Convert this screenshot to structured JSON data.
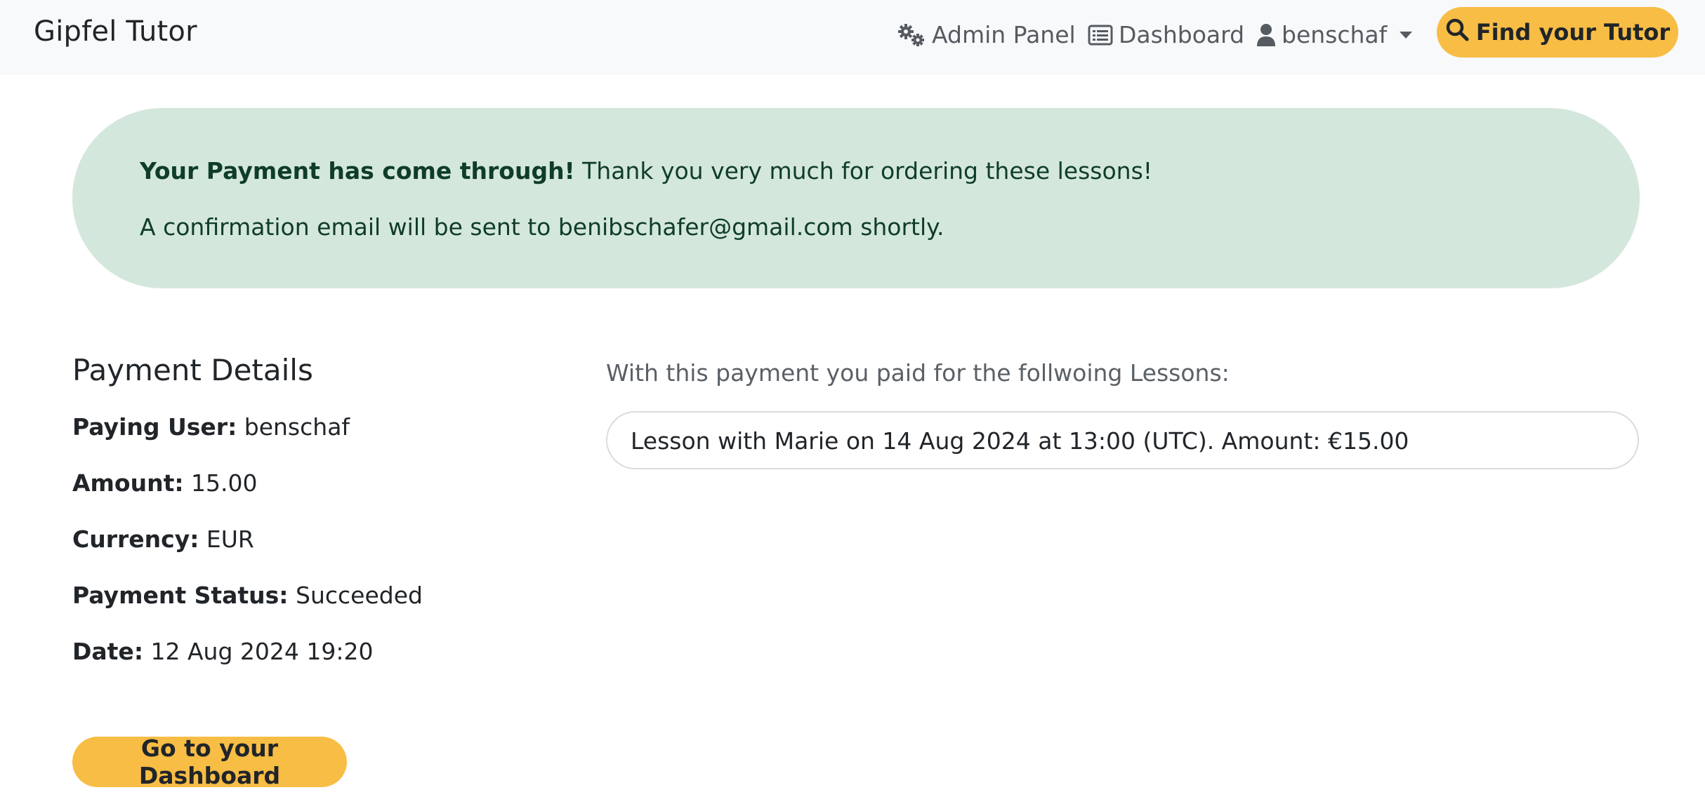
{
  "navbar": {
    "brand": "Gipfel Tutor",
    "admin_label": "Admin Panel",
    "dashboard_label": "Dashboard",
    "user_label": "benschaf",
    "find_button_label": "Find your Tutor"
  },
  "alert": {
    "bold_text": "Your Payment has come through!",
    "rest_text": " Thank you very much for ordering these lessons!",
    "email_line": "A confirmation email will be sent to benibschafer@gmail.com shortly."
  },
  "payment_details": {
    "title": "Payment Details",
    "items": [
      {
        "label": "Paying User:",
        "value": " benschaf"
      },
      {
        "label": "Amount:",
        "value": " 15.00"
      },
      {
        "label": "Currency:",
        "value": " EUR"
      },
      {
        "label": "Payment Status:",
        "value": " Succeeded"
      },
      {
        "label": "Date:",
        "value": " 12 Aug 2024 19:20"
      }
    ]
  },
  "lessons": {
    "intro": "With this payment you paid for the follwoing Lessons:",
    "items": [
      "Lesson with Marie on 14 Aug 2024 at 13:00 (UTC). Amount: €15.00"
    ]
  },
  "dashboard_button_label": "Go to your Dashboard",
  "colors": {
    "accent": "#f7bd45",
    "navbar_bg": "#f8f9fa",
    "alert_bg": "#d4e7dd",
    "alert_text": "#0f3d27"
  },
  "icons": {
    "admin": "gears-icon",
    "dashboard": "list-alt-icon",
    "user": "user-icon",
    "find": "search-icon"
  }
}
